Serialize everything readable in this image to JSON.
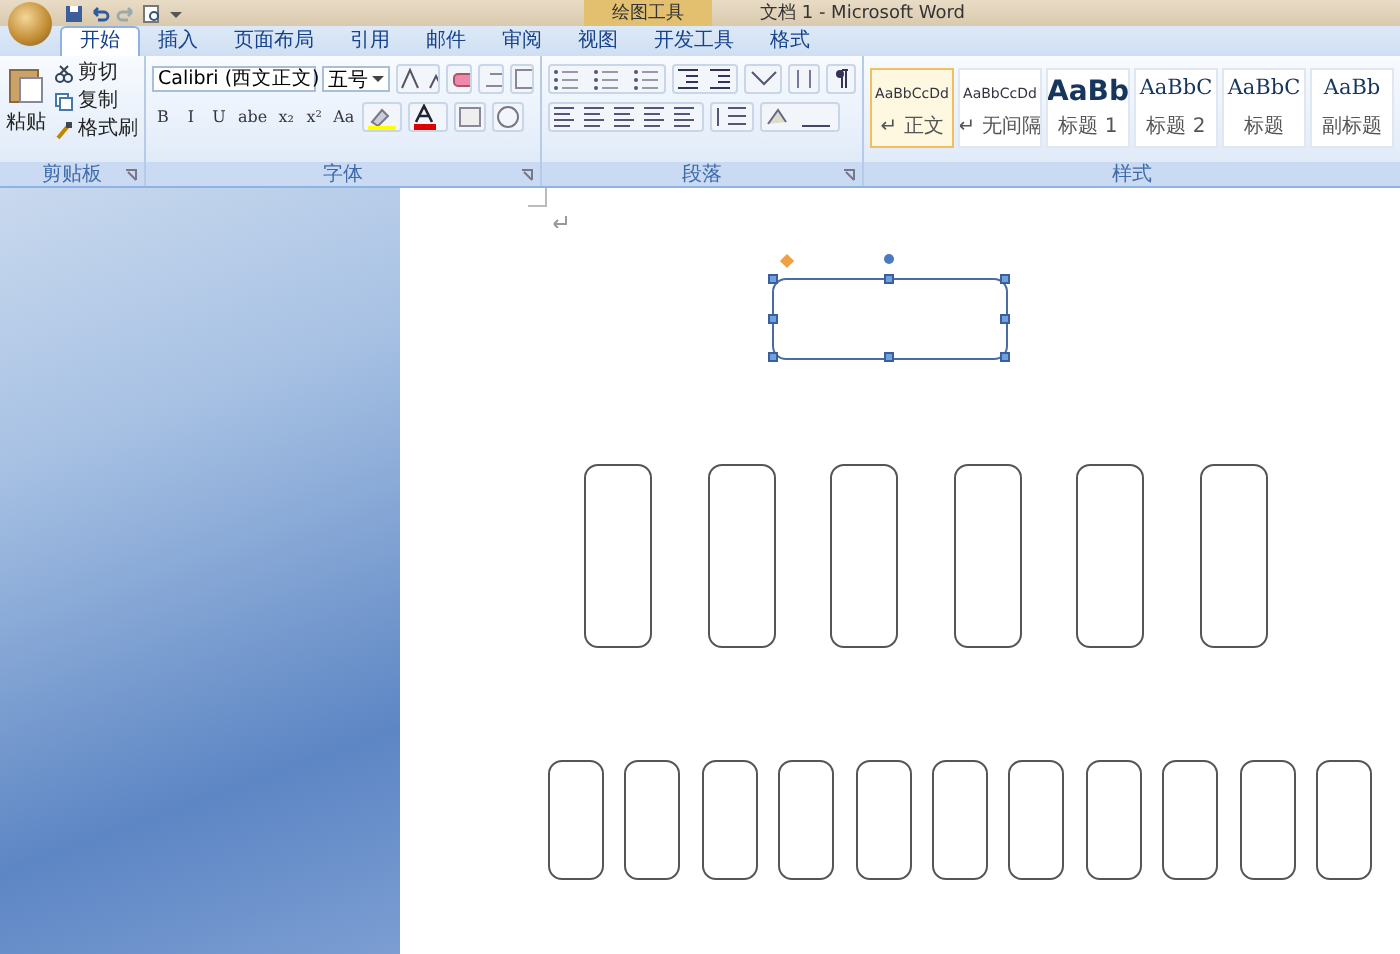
{
  "window": {
    "title": "文档 1 - Microsoft Word",
    "context_tab_group": "绘图工具"
  },
  "tabs": [
    {
      "label": "开始",
      "selected": true
    },
    {
      "label": "插入",
      "selected": false
    },
    {
      "label": "页面布局",
      "selected": false
    },
    {
      "label": "引用",
      "selected": false
    },
    {
      "label": "邮件",
      "selected": false
    },
    {
      "label": "审阅",
      "selected": false
    },
    {
      "label": "视图",
      "selected": false
    },
    {
      "label": "开发工具",
      "selected": false
    },
    {
      "label": "格式",
      "selected": false
    }
  ],
  "clipboard": {
    "title": "剪贴板",
    "paste": "粘贴",
    "items": [
      "剪切",
      "复制",
      "格式刷"
    ]
  },
  "font": {
    "title": "字体",
    "font_name": "Calibri (西文正文)",
    "font_size": "五号",
    "format_buttons": [
      "B",
      "I",
      "U",
      "abe",
      "x₂",
      "x²",
      "Aa"
    ]
  },
  "paragraph": {
    "title": "段落"
  },
  "styles": {
    "title": "样式",
    "items": [
      {
        "sample": "AaBbCcDd",
        "label": "↵ 正文",
        "kind": "small",
        "selected": true
      },
      {
        "sample": "AaBbCcDd",
        "label": "↵ 无间隔",
        "kind": "small",
        "selected": false
      },
      {
        "sample": "AaBb",
        "label": "标题 1",
        "kind": "heading",
        "selected": false
      },
      {
        "sample": "AaBbC",
        "label": "标题 2",
        "kind": "serif",
        "selected": false
      },
      {
        "sample": "AaBbC",
        "label": "标题",
        "kind": "serif",
        "selected": false
      },
      {
        "sample": "AaBb",
        "label": "副标题",
        "kind": "serif",
        "selected": false
      }
    ]
  },
  "canvas": {
    "top_shapes": [
      {
        "selected": true
      }
    ],
    "row_1": [
      {
        "selected": false
      },
      {
        "selected": false
      },
      {
        "selected": false
      },
      {
        "selected": false
      },
      {
        "selected": false
      },
      {
        "selected": false
      }
    ],
    "row_2": [
      {
        "selected": false
      },
      {
        "selected": false
      },
      {
        "selected": false
      },
      {
        "selected": false
      },
      {
        "selected": false
      },
      {
        "selected": false
      },
      {
        "selected": false
      },
      {
        "selected": false
      },
      {
        "selected": false
      },
      {
        "selected": false
      },
      {
        "selected": false
      }
    ]
  }
}
